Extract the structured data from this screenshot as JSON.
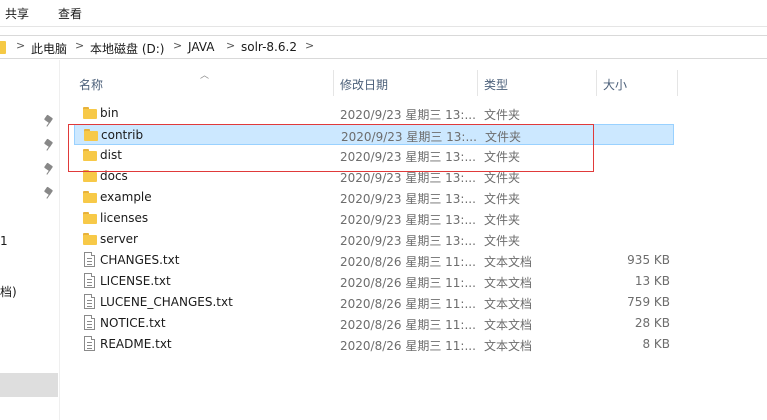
{
  "ribbon": {
    "tabs": [
      "共享",
      "查看"
    ]
  },
  "address": {
    "crumbs": [
      "此电脑",
      "本地磁盘 (D:)",
      "JAVA",
      "solr-8.6.2"
    ],
    "separator": ">"
  },
  "nav": {
    "partial_labels": [
      "1",
      "档)"
    ]
  },
  "columns": {
    "name": "名称",
    "modified": "修改日期",
    "type": "类型",
    "size": "大小"
  },
  "files": [
    {
      "name": "bin",
      "modified": "2020/9/23 星期三 13:...",
      "type": "文件夹",
      "size": "",
      "icon": "folder-icon"
    },
    {
      "name": "contrib",
      "modified": "2020/9/23 星期三 13:...",
      "type": "文件夹",
      "size": "",
      "icon": "folder-icon",
      "selected": true
    },
    {
      "name": "dist",
      "modified": "2020/9/23 星期三 13:...",
      "type": "文件夹",
      "size": "",
      "icon": "folder-icon"
    },
    {
      "name": "docs",
      "modified": "2020/9/23 星期三 13:...",
      "type": "文件夹",
      "size": "",
      "icon": "folder-icon"
    },
    {
      "name": "example",
      "modified": "2020/9/23 星期三 13:...",
      "type": "文件夹",
      "size": "",
      "icon": "folder-icon"
    },
    {
      "name": "licenses",
      "modified": "2020/9/23 星期三 13:...",
      "type": "文件夹",
      "size": "",
      "icon": "folder-icon"
    },
    {
      "name": "server",
      "modified": "2020/9/23 星期三 13:...",
      "type": "文件夹",
      "size": "",
      "icon": "folder-icon"
    },
    {
      "name": "CHANGES.txt",
      "modified": "2020/8/26 星期三 11:...",
      "type": "文本文档",
      "size": "935 KB",
      "icon": "text-file-icon"
    },
    {
      "name": "LICENSE.txt",
      "modified": "2020/8/26 星期三 11:...",
      "type": "文本文档",
      "size": "13 KB",
      "icon": "text-file-icon"
    },
    {
      "name": "LUCENE_CHANGES.txt",
      "modified": "2020/8/26 星期三 11:...",
      "type": "文本文档",
      "size": "759 KB",
      "icon": "text-file-icon"
    },
    {
      "name": "NOTICE.txt",
      "modified": "2020/8/26 星期三 11:...",
      "type": "文本文档",
      "size": "28 KB",
      "icon": "text-file-icon"
    },
    {
      "name": "README.txt",
      "modified": "2020/8/26 星期三 11:...",
      "type": "文本文档",
      "size": "8 KB",
      "icon": "text-file-icon"
    }
  ],
  "colors": {
    "selection_bg": "#cce8ff",
    "selection_border": "#99d1ff",
    "annotation_box": "#e03a3a",
    "folder": "#f7c948"
  }
}
